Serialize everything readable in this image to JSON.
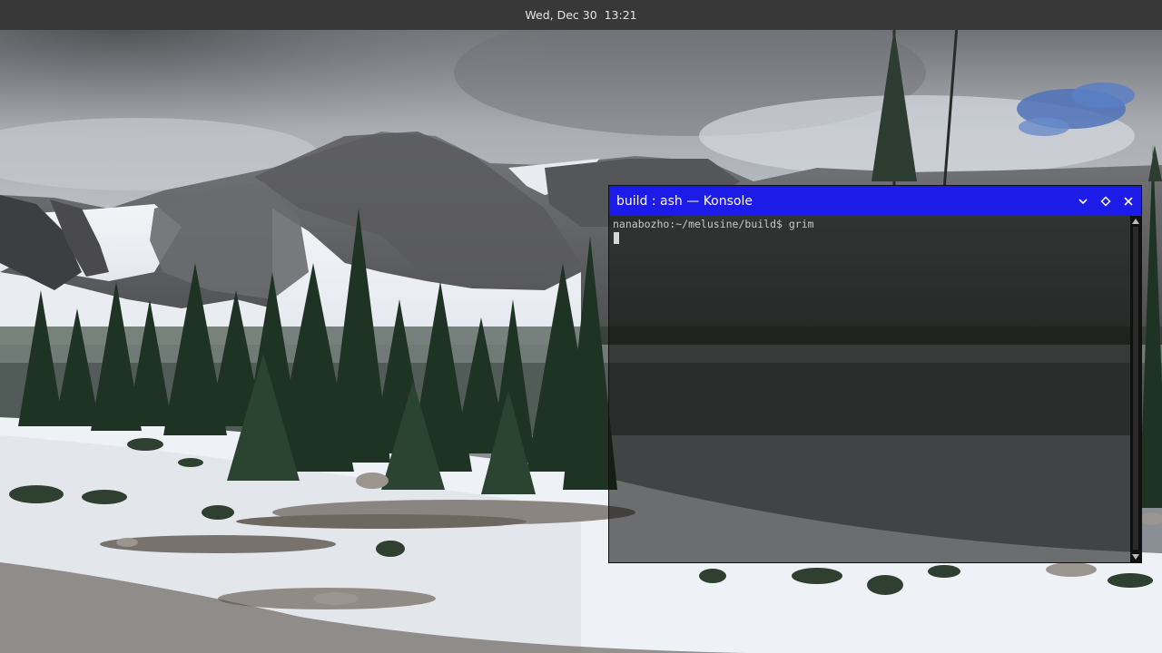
{
  "topbar": {
    "clock": "Wed, Dec 30  13:21"
  },
  "konsole": {
    "title": "build : ash — Konsole",
    "buttons": {
      "minimize_icon": "chevron-down-icon",
      "maximize_icon": "diamond-icon",
      "close_icon": "close-icon"
    },
    "terminal": {
      "prompt_line": "nanabozho:~/melusine/build$ grim"
    },
    "scrollbar_position": 1.0
  },
  "colors": {
    "topbar_bg": "#383838",
    "titlebar_bg": "#1c1be8",
    "terminal_text": "#c9c9c9"
  },
  "wallpaper": {
    "icon": "mountain-landscape-wallpaper"
  }
}
